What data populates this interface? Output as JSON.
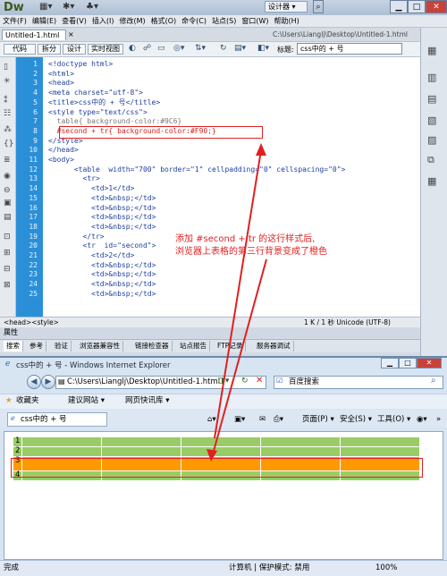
{
  "dw": {
    "logo": "Dw",
    "workspace": "设计器 ▾",
    "menu": [
      "文件(F)",
      "编辑(E)",
      "查看(V)",
      "插入(I)",
      "修改(M)",
      "格式(O)",
      "命令(C)",
      "站点(S)",
      "窗口(W)",
      "帮助(H)"
    ],
    "doc_tab": "Untitled-1.html",
    "doc_path": "C:\\Users\\Lianglj\\Desktop\\Untitled-1.html",
    "view_buttons": [
      "代码",
      "拆分",
      "设计",
      "实时视图"
    ],
    "title_label": "标题:",
    "title_value": "css中的 + 号",
    "line_numbers": [
      "1",
      "2",
      "3",
      "4",
      "5",
      "6",
      "7",
      "8",
      "9",
      "10",
      "11",
      "12",
      "13",
      "14",
      "15",
      "16",
      "17",
      "18",
      "19",
      "20",
      "21",
      "22",
      "23",
      "24",
      "25"
    ],
    "code_lines": [
      "<!doctype html>",
      "<html>",
      "<head>",
      "<meta charset=\"utf-8\">",
      "<title>css中的 + 号</title>",
      "<style type=\"text/css\">",
      "  table{ background-color:#9C6}",
      "  #second + tr{ background-color:#F90;}",
      "</style>",
      "</head>",
      "<body>",
      "      <table  width=\"700\" border=\"1\" cellpadding=\"0\" cellspacing=\"0\">",
      "        <tr>",
      "          <td>1</td>",
      "          <td>&nbsp;</td>",
      "          <td>&nbsp;</td>",
      "          <td>&nbsp;</td>",
      "          <td>&nbsp;</td>",
      "        </tr>",
      "        <tr  id=\"second\">",
      "          <td>2</td>",
      "          <td>&nbsp;</td>",
      "          <td>&nbsp;</td>",
      "          <td>&nbsp;</td>",
      "          <td>&nbsp;</td>"
    ],
    "annotation_line1": "添加 #second + tr 的这行样式后,",
    "annotation_line2": "浏览器上表格的第三行背景变成了橙色",
    "tag_path": "<head><style>",
    "status_right": "1 K / 1 秒  Unicode (UTF-8)",
    "panel_title": "属性",
    "bottom_tabs": [
      "搜索",
      "参考",
      "验证",
      "浏览器兼容性",
      "链接检查器",
      "站点报告",
      "FTP记录",
      "服务器调试"
    ]
  },
  "ie": {
    "title": "css中的 + 号 - Windows Internet Explorer",
    "address": "C:\\Users\\Lianglj\\Desktop\\Untitled-1.html",
    "search_placeholder": "百度搜索",
    "favorites": "收藏夹",
    "fav_links": [
      "建议网站 ▾",
      "网页快讯库 ▾"
    ],
    "tab_title": "css中的 + 号",
    "commands": [
      "页面(P) ▾",
      "安全(S) ▾",
      "工具(O) ▾"
    ],
    "rows": [
      "1",
      "2",
      "3",
      "4"
    ],
    "status_left": "完成",
    "status_zone": "计算机 | 保护模式: 禁用",
    "zoom": "100%"
  },
  "colors": {
    "table_bg": "#99CC66",
    "orange": "#FF9900",
    "annotation": "#E02020"
  }
}
